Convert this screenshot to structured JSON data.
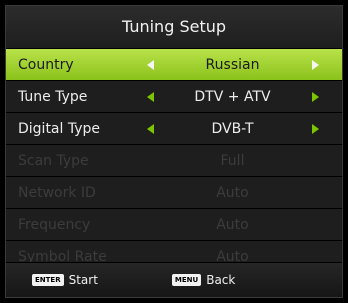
{
  "title": "Tuning Setup",
  "rows": [
    {
      "label": "Country",
      "value": "Russian",
      "state": "selected"
    },
    {
      "label": "Tune Type",
      "value": "DTV + ATV",
      "state": "active"
    },
    {
      "label": "Digital Type",
      "value": "DVB-T",
      "state": "active"
    },
    {
      "label": "Scan Type",
      "value": "Full",
      "state": "disabled"
    },
    {
      "label": "Network ID",
      "value": "Auto",
      "state": "disabled"
    },
    {
      "label": "Frequency",
      "value": "Auto",
      "state": "disabled"
    },
    {
      "label": "Symbol Rate",
      "value": "Auto",
      "state": "disabled"
    }
  ],
  "footer": {
    "enter_key": "ENTER",
    "enter_label": "Start",
    "menu_key": "MENU",
    "menu_label": "Back"
  },
  "colors": {
    "selected_green": "#9ccf2a",
    "arrow_green": "#7cc400",
    "panel_bg": "#1b1b1b",
    "disabled_text": "#3c3c3c"
  }
}
